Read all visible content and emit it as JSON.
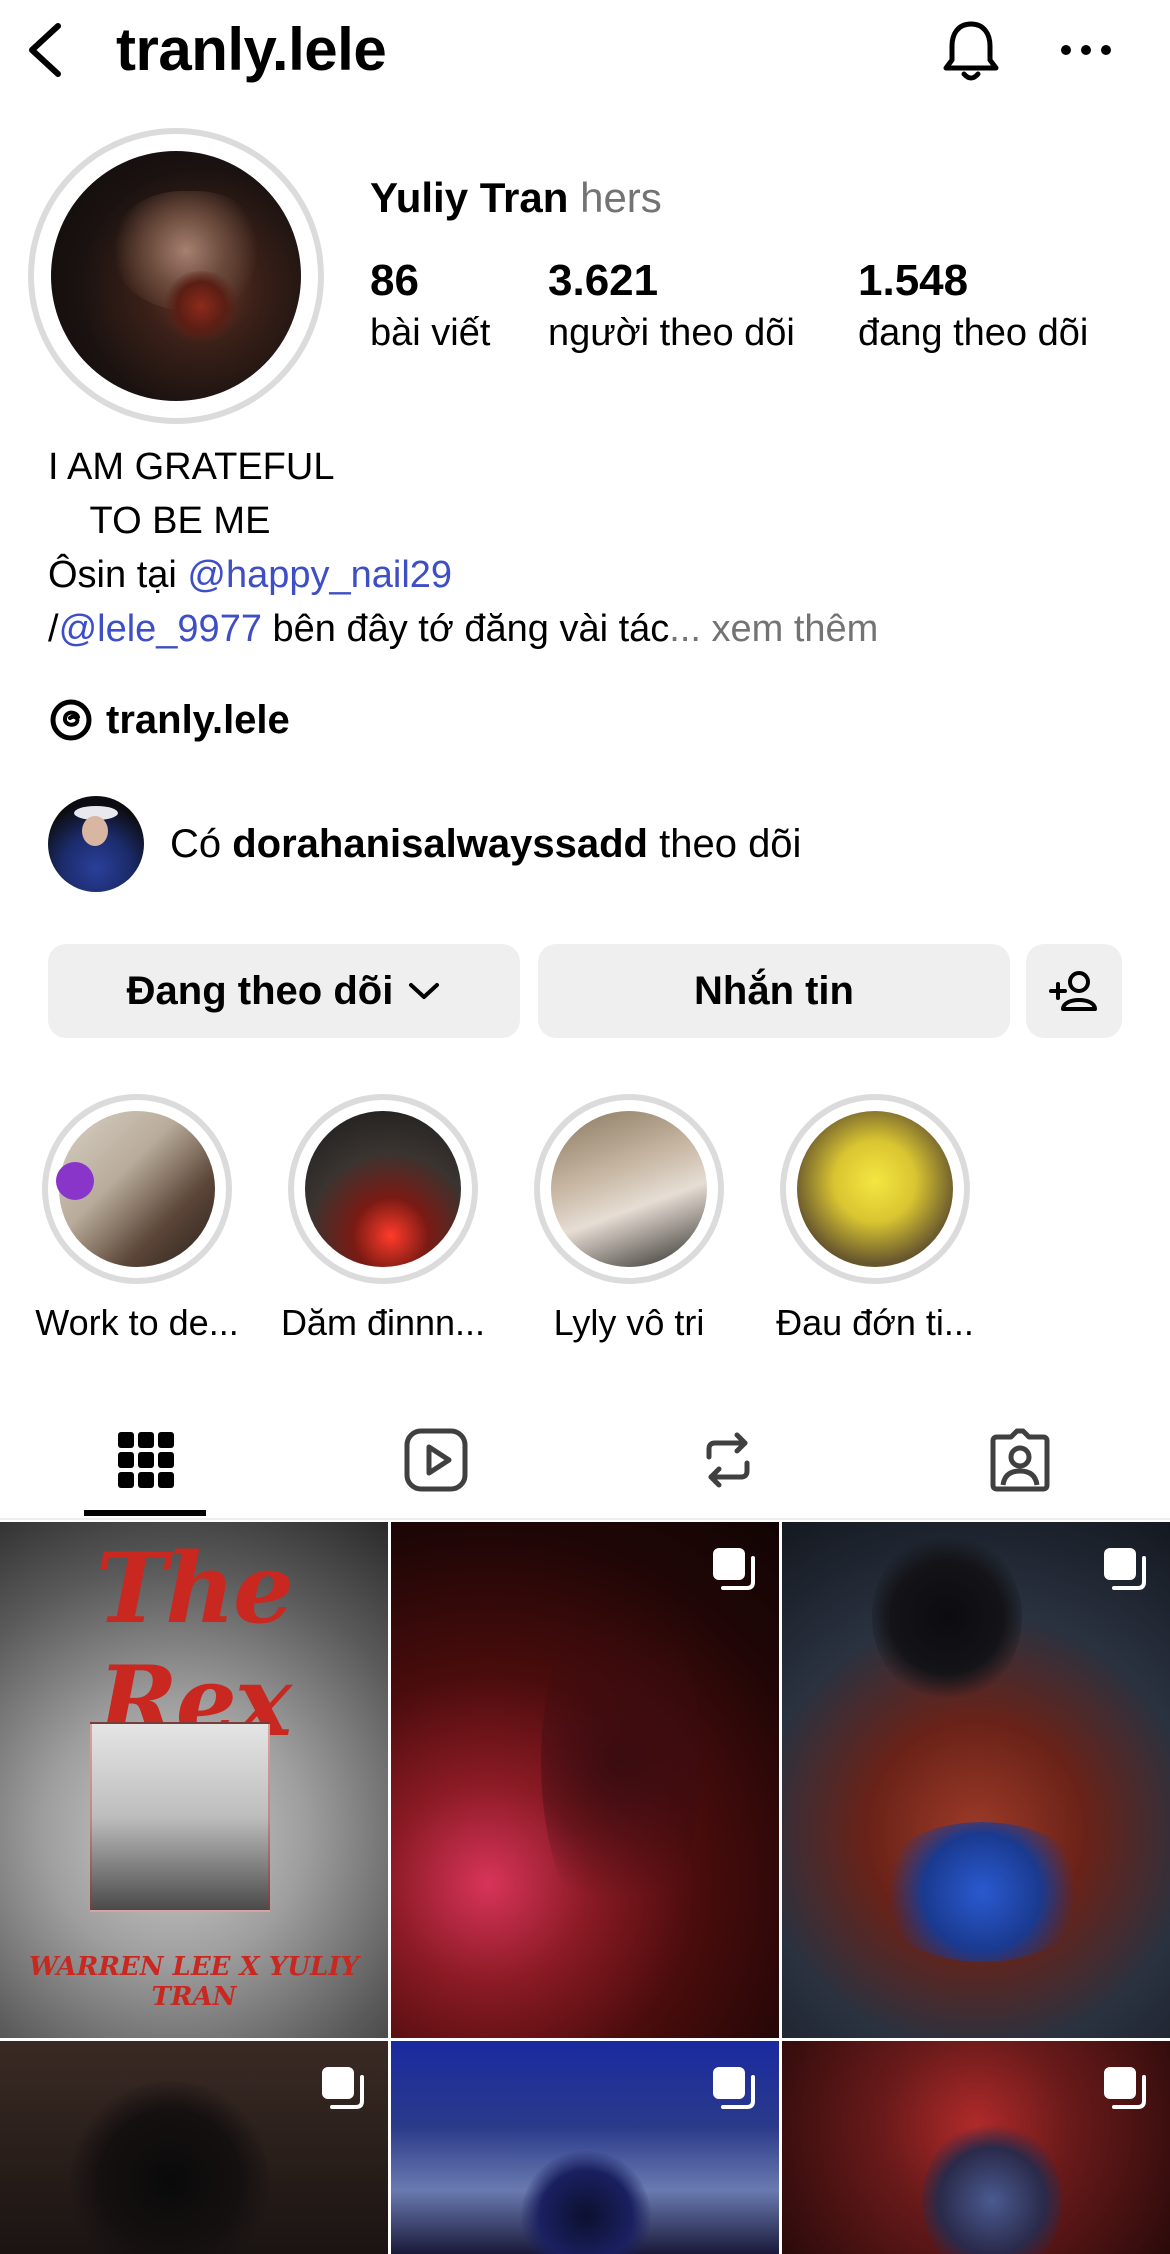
{
  "header": {
    "username": "tranly.lele"
  },
  "profile": {
    "display_name": "Yuliy Tran",
    "pronouns": "hers",
    "stats": [
      {
        "value": "86",
        "label": "bài viết"
      },
      {
        "value": "3.621",
        "label": "người theo dõi"
      },
      {
        "value": "1.548",
        "label": "đang theo dõi"
      }
    ],
    "bio": {
      "line1": "I AM GRATEFUL",
      "line2": "    TO BE ME",
      "line3_prefix": "Ôsin tại ",
      "line3_link": "@happy_nail29",
      "line4_prefix": "/",
      "line4_link": "@lele_9977",
      "line4_text": " bên đây tớ đăng vài tác",
      "line4_more": "... xem thêm"
    },
    "threads_handle": "tranly.lele",
    "followed_by": {
      "prefix": "Có ",
      "name": "dorahanisalwayssadd",
      "suffix": " theo dõi"
    }
  },
  "actions": {
    "following_label": "Đang theo dõi",
    "message_label": "Nhắn tin"
  },
  "highlights": [
    {
      "label": "Work to de..."
    },
    {
      "label": "Dăm đinnn..."
    },
    {
      "label": "Lyly vô tri"
    },
    {
      "label": "Đau đớn ti..."
    }
  ],
  "tabs": [
    {
      "icon": "grid-icon",
      "active": true
    },
    {
      "icon": "reels-icon",
      "active": false
    },
    {
      "icon": "reposts-icon",
      "active": false
    },
    {
      "icon": "tagged-icon",
      "active": false
    }
  ],
  "posts": {
    "post1_title": "The Rex",
    "post1_subtitle": "WARREN LEE X YULIY TRAN"
  },
  "colors": {
    "link": "#3e4fc5",
    "muted": "#737373",
    "button_bg": "#efefef",
    "ring": "#dbdbdb"
  }
}
